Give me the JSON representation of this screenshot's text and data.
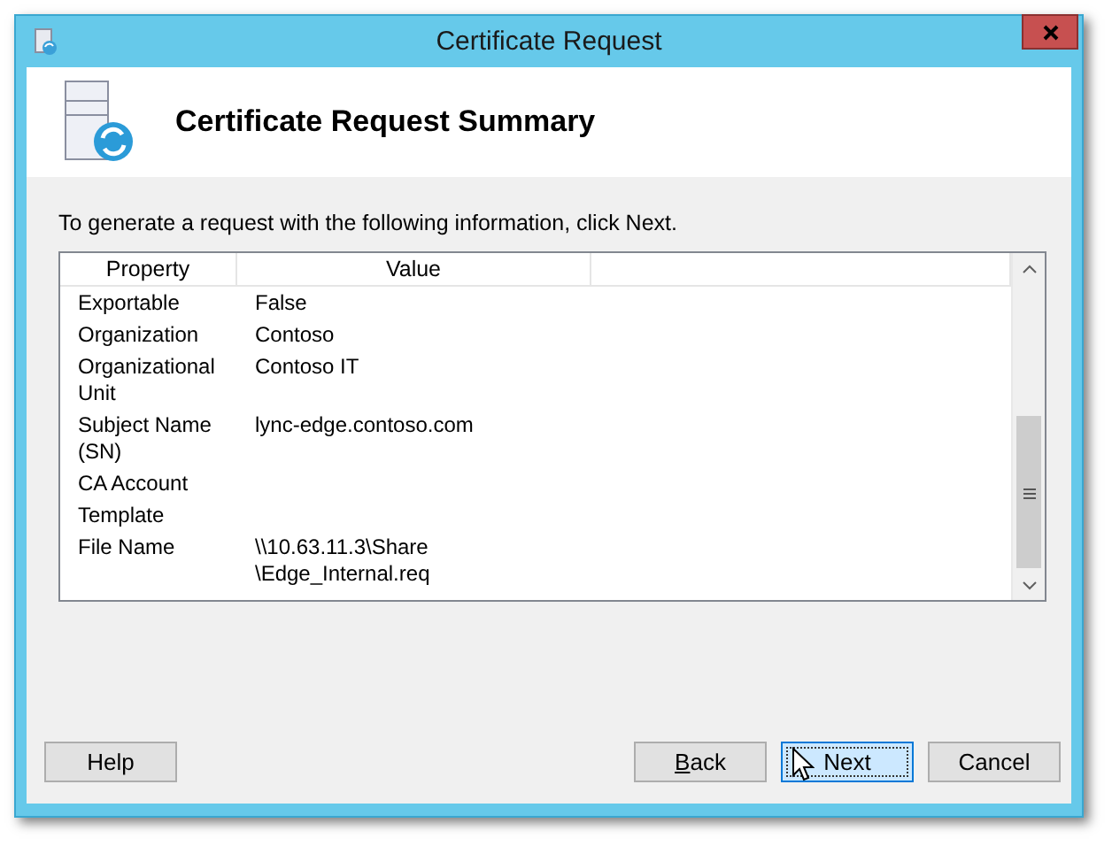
{
  "window": {
    "title": "Certificate Request"
  },
  "header": {
    "title": "Certificate Request Summary"
  },
  "intro": "To generate a request with the following information, click Next.",
  "table": {
    "columns": [
      "Property",
      "Value"
    ],
    "rows": [
      {
        "property": "Exportable",
        "value": "False"
      },
      {
        "property": "Organization",
        "value": "Contoso"
      },
      {
        "property": "Organizational Unit",
        "value": "Contoso IT"
      },
      {
        "property": "Subject Name (SN)",
        "value": "lync-edge.contoso.com"
      },
      {
        "property": "CA Account",
        "value": ""
      },
      {
        "property": "Template",
        "value": ""
      },
      {
        "property": "File Name",
        "value": "\\\\10.63.11.3\\Share \\Edge_Internal.req"
      }
    ]
  },
  "buttons": [
    {
      "label": "Help",
      "kind": "help",
      "focused": false,
      "underline_first": false
    },
    {
      "label": "Back",
      "kind": "nav",
      "focused": false,
      "underline_first": true
    },
    {
      "label": "Next",
      "kind": "nav",
      "focused": true,
      "underline_first": false
    },
    {
      "label": "Cancel",
      "kind": "nav",
      "focused": false,
      "underline_first": false
    }
  ]
}
